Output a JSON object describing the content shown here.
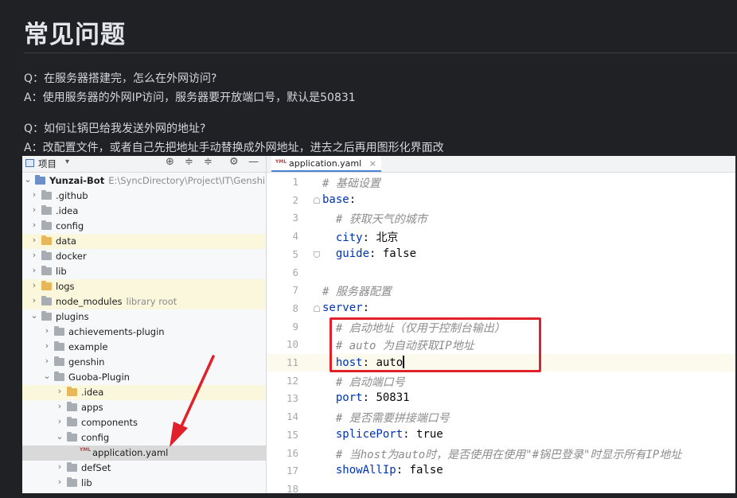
{
  "page": {
    "title": "常见问题",
    "qa": [
      {
        "q": "Q：在服务器搭建完，怎么在外网访问?",
        "a": "A：使用服务器的外网IP访问，服务器要开放端口号，默认是50831"
      },
      {
        "q": "Q：如何让锅巴给我发送外网的地址?",
        "a": "A：改配置文件，或者自己先把地址手动替换成外网地址，进去之后再用图形化界面改"
      }
    ]
  },
  "ide": {
    "project_panel": {
      "label": "项目",
      "dropdown": "▾",
      "toolbar": [
        "⊕",
        "≑",
        "≑",
        "⚙",
        "—"
      ],
      "tree": [
        {
          "name": "Yunzai-Bot",
          "extra": "E:\\SyncDirectory\\Project\\IT\\GenshinBot",
          "depth": 0,
          "chev": "⌄",
          "kind": "root"
        },
        {
          "name": ".github",
          "depth": 1,
          "chev": "›",
          "kind": "folder"
        },
        {
          "name": ".idea",
          "depth": 1,
          "chev": "›",
          "kind": "folder"
        },
        {
          "name": "config",
          "depth": 1,
          "chev": "›",
          "kind": "folder"
        },
        {
          "name": "data",
          "depth": 1,
          "chev": "›",
          "kind": "folder-orange",
          "highlight": true
        },
        {
          "name": "docker",
          "depth": 1,
          "chev": "›",
          "kind": "folder"
        },
        {
          "name": "lib",
          "depth": 1,
          "chev": "›",
          "kind": "folder"
        },
        {
          "name": "logs",
          "depth": 1,
          "chev": "›",
          "kind": "folder-orange",
          "highlight": true
        },
        {
          "name": "node_modules",
          "extra": "library root",
          "depth": 1,
          "chev": "›",
          "kind": "folder",
          "highlight": true
        },
        {
          "name": "plugins",
          "depth": 1,
          "chev": "⌄",
          "kind": "folder"
        },
        {
          "name": "achievements-plugin",
          "depth": 2,
          "chev": "›",
          "kind": "folder"
        },
        {
          "name": "example",
          "depth": 2,
          "chev": "›",
          "kind": "folder"
        },
        {
          "name": "genshin",
          "depth": 2,
          "chev": "›",
          "kind": "folder"
        },
        {
          "name": "Guoba-Plugin",
          "depth": 2,
          "chev": "⌄",
          "kind": "folder"
        },
        {
          "name": ".idea",
          "depth": 3,
          "chev": "›",
          "kind": "folder-orange",
          "highlight": true
        },
        {
          "name": "apps",
          "depth": 3,
          "chev": "›",
          "kind": "folder"
        },
        {
          "name": "components",
          "depth": 3,
          "chev": "›",
          "kind": "folder"
        },
        {
          "name": "config",
          "depth": 3,
          "chev": "⌄",
          "kind": "folder"
        },
        {
          "name": "application.yaml",
          "depth": 4,
          "chev": "",
          "kind": "yaml",
          "selected": true
        },
        {
          "name": "defSet",
          "depth": 3,
          "chev": "›",
          "kind": "folder"
        },
        {
          "name": "lib",
          "depth": 3,
          "chev": "›",
          "kind": "folder"
        }
      ]
    },
    "editor": {
      "tab_label": "application.yaml",
      "tab_close": "×",
      "file_badge": "YML",
      "lines": [
        {
          "n": "1",
          "indent": "",
          "comment": "# 基础设置"
        },
        {
          "n": "2",
          "indent": "",
          "key": "base",
          "sep": ":"
        },
        {
          "n": "3",
          "indent": "  ",
          "comment": "# 获取天气的城市"
        },
        {
          "n": "4",
          "indent": "  ",
          "key": "city",
          "sep": ": ",
          "value": "北京"
        },
        {
          "n": "5",
          "indent": "  ",
          "key": "guide",
          "sep": ": ",
          "value": "false"
        },
        {
          "n": "6",
          "indent": ""
        },
        {
          "n": "7",
          "indent": "",
          "comment": "# 服务器配置"
        },
        {
          "n": "8",
          "indent": "",
          "key": "server",
          "sep": ":"
        },
        {
          "n": "9",
          "indent": "  ",
          "comment": "# 启动地址（仅用于控制台输出）"
        },
        {
          "n": "10",
          "indent": "  ",
          "comment": "# auto 为自动获取IP地址"
        },
        {
          "n": "11",
          "indent": "  ",
          "key": "host",
          "sep": ": ",
          "value": "auto",
          "current": true
        },
        {
          "n": "12",
          "indent": "  ",
          "comment": "# 启动端口号"
        },
        {
          "n": "13",
          "indent": "  ",
          "key": "port",
          "sep": ": ",
          "value": "50831"
        },
        {
          "n": "14",
          "indent": "  ",
          "comment": "# 是否需要拼接端口号"
        },
        {
          "n": "15",
          "indent": "  ",
          "key": "splicePort",
          "sep": ": ",
          "value": "true"
        },
        {
          "n": "16",
          "indent": "  ",
          "comment": "# 当host为auto时，是否使用在使用\"#锅巴登录\"时显示所有IP地址"
        },
        {
          "n": "17",
          "indent": "  ",
          "key": "showAllIp",
          "sep": ": ",
          "value": "false"
        },
        {
          "n": "18",
          "indent": ""
        }
      ]
    }
  },
  "colors": {
    "annotation_red": "#e0202a",
    "keyword_blue": "#0033b3",
    "comment_gray": "#8c8c8c"
  },
  "icons": [
    "panel-icon",
    "locate-icon",
    "expand-all-icon",
    "collapse-all-icon",
    "gear-icon",
    "hide-icon",
    "chevron-right-icon",
    "chevron-down-icon",
    "folder-icon",
    "yaml-file-icon",
    "close-icon"
  ]
}
